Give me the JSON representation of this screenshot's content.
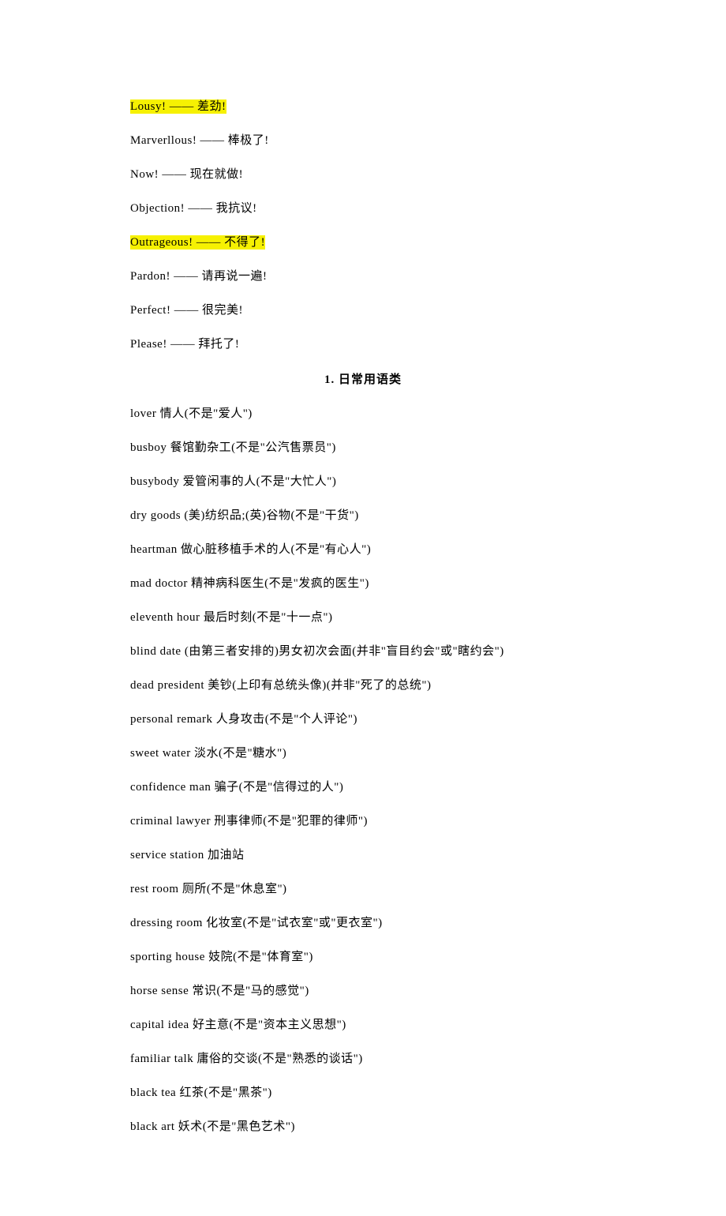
{
  "expressions": [
    {
      "text": "Lousy! —— 差劲!",
      "highlighted": true
    },
    {
      "text": "Marverllous! —— 棒极了!",
      "highlighted": false
    },
    {
      "text": "Now! —— 现在就做!",
      "highlighted": false
    },
    {
      "text": "Objection! —— 我抗议!",
      "highlighted": false
    },
    {
      "text": "Outrageous! —— 不得了!",
      "highlighted": true
    },
    {
      "text": "Pardon! —— 请再说一遍!",
      "highlighted": false
    },
    {
      "text": "Perfect! —— 很完美!",
      "highlighted": false
    },
    {
      "text": "Please! —— 拜托了!",
      "highlighted": false
    }
  ],
  "section_title": "1. 日常用语类",
  "vocab": [
    "lover 情人(不是\"爱人\")",
    "busboy 餐馆勤杂工(不是\"公汽售票员\")",
    "busybody 爱管闲事的人(不是\"大忙人\")",
    "dry goods (美)纺织品;(英)谷物(不是\"干货\")",
    "heartman 做心脏移植手术的人(不是\"有心人\")",
    "mad doctor 精神病科医生(不是\"发疯的医生\")",
    "eleventh hour 最后时刻(不是\"十一点\")",
    "blind date (由第三者安排的)男女初次会面(并非\"盲目约会\"或\"瞎约会\")",
    "dead president 美钞(上印有总统头像)(并非\"死了的总统\")",
    "personal remark 人身攻击(不是\"个人评论\")",
    "sweet water 淡水(不是\"糖水\")",
    "confidence man 骗子(不是\"信得过的人\")",
    "criminal lawyer 刑事律师(不是\"犯罪的律师\")",
    "service station 加油站",
    "rest room 厕所(不是\"休息室\")",
    "dressing room 化妆室(不是\"试衣室\"或\"更衣室\")",
    "sporting house 妓院(不是\"体育室\")",
    "horse sense 常识(不是\"马的感觉\")",
    "capital idea 好主意(不是\"资本主义思想\")",
    "familiar talk 庸俗的交谈(不是\"熟悉的谈话\")",
    "black tea 红茶(不是\"黑茶\")",
    "black art 妖术(不是\"黑色艺术\")"
  ]
}
